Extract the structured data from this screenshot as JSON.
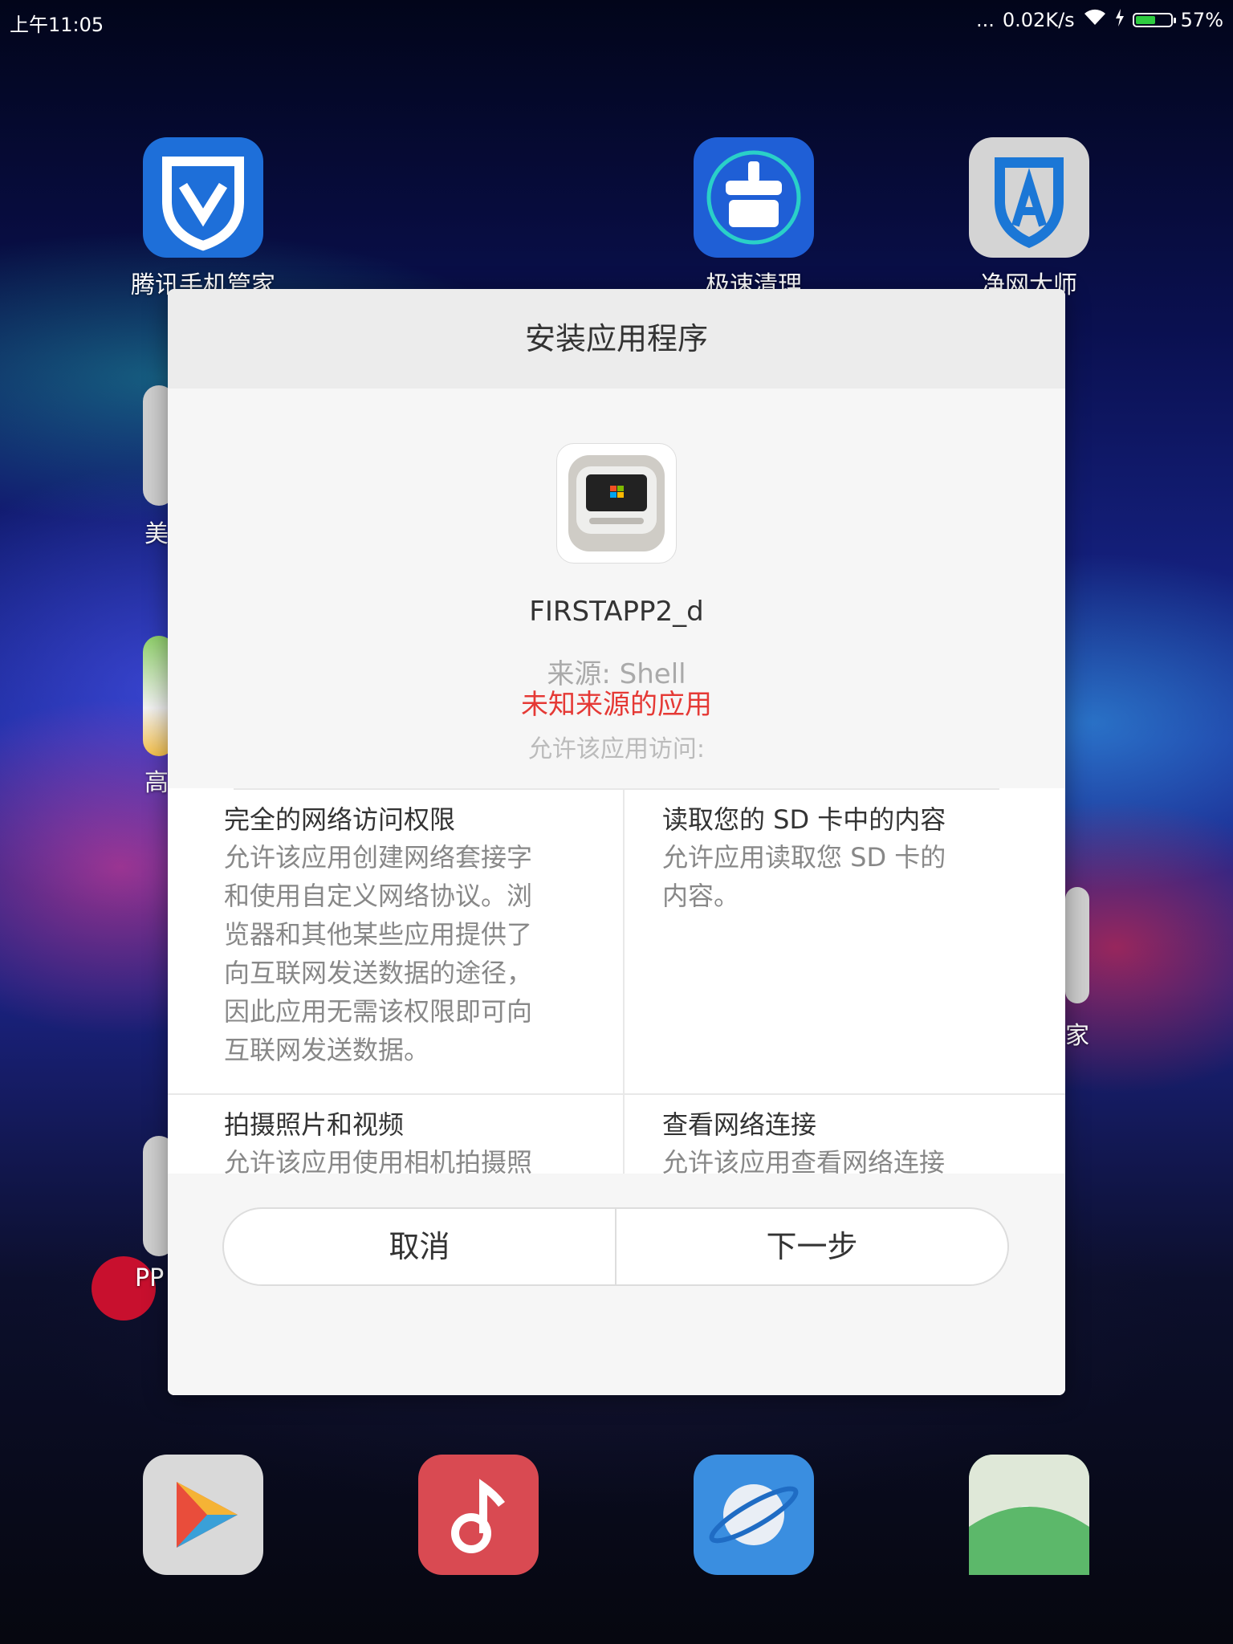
{
  "status_bar": {
    "time": "上午11:05",
    "signal_dots": "...",
    "net_speed": "0.02K/s",
    "battery": "57%",
    "battery_level": 0.57
  },
  "home_apps_top": [
    {
      "label": "腾讯手机管家",
      "color": "#1e6fd9",
      "icon": "shield-v-icon"
    },
    {
      "label": "极速清理",
      "color": "#1f5fd6",
      "icon": "broom-icon"
    },
    {
      "label": "净网大师",
      "color": "#c9c9c9",
      "icon": "shield-a-icon"
    }
  ],
  "home_apps_side": [
    {
      "label": "美"
    },
    {
      "label": "高"
    },
    {
      "label": "PP"
    },
    {
      "label": "家"
    }
  ],
  "dock_apps": [
    {
      "name": "play-store-icon",
      "color": "#d9d9d9"
    },
    {
      "name": "music-icon",
      "color": "#d94a52"
    },
    {
      "name": "browser-icon",
      "color": "#3a8ee0"
    },
    {
      "name": "gallery-icon",
      "color": "#5cb86a"
    }
  ],
  "dialog": {
    "title": "安装应用程序",
    "app_name": "FIRSTAPP2_d",
    "source": "来源: Shell",
    "warning": "未知来源的应用",
    "allow_label": "允许该应用访问:",
    "permissions": [
      {
        "title": "完全的网络访问权限",
        "desc": [
          "允许该应用创建网络套接字",
          "和使用自定义网络协议。浏",
          "览器和其他某些应用提供了",
          "向互联网发送数据的途径，",
          "因此应用无需该权限即可向",
          "互联网发送数据。"
        ]
      },
      {
        "title": "读取您的 SD 卡中的内容",
        "desc": [
          "允许应用读取您 SD 卡的",
          "内容。"
        ]
      },
      {
        "title": "拍摄照片和视频",
        "desc": [
          "允许该应用使用相机拍摄照"
        ]
      },
      {
        "title": "查看网络连接",
        "desc": [
          "允许该应用查看网络连接"
        ]
      }
    ],
    "cancel_label": "取消",
    "next_label": "下一步"
  }
}
